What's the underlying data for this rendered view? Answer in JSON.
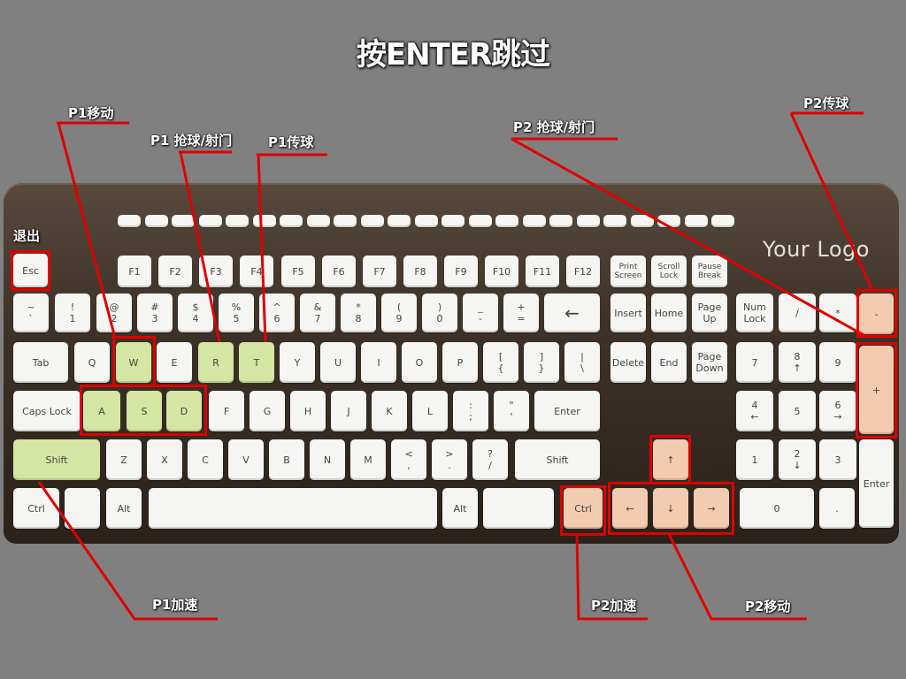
{
  "title": "按ENTER跳过",
  "logo": "Your Logo",
  "labels": {
    "exit": "退出",
    "p1_move": "P1移动",
    "p1_shoot": "P1 抢球/射门",
    "p1_pass": "P1传球",
    "p1_speed": "P1加速",
    "p2_shoot": "P2 抢球/射门",
    "p2_pass": "P2传球",
    "p2_speed": "P2加速",
    "p2_move": "P2移动"
  },
  "keys": {
    "esc": "Esc",
    "f1": "F1",
    "f2": "F2",
    "f3": "F3",
    "f4": "F4",
    "f5": "F5",
    "f6": "F6",
    "f7": "F7",
    "f8": "F8",
    "f9": "F9",
    "f10": "F10",
    "f11": "F11",
    "f12": "F12",
    "print": "Print\nScreen",
    "scroll": "Scroll\nLock",
    "pause": "Pause\nBreak",
    "tilde": "~\n`",
    "n1": "!\n1",
    "n2": "@\n2",
    "n3": "#\n3",
    "n4": "$\n4",
    "n5": "%\n5",
    "n6": "^\n6",
    "n7": "&\n7",
    "n8": "*\n8",
    "n9": "(\n9",
    "n0": ")\n0",
    "minus": "_\n-",
    "plus": "+\n=",
    "backspace": "←",
    "insert": "Insert",
    "home": "Home",
    "pgup": "Page\nUp",
    "numlock": "Num\nLock",
    "np_div": "/",
    "np_mul": "*",
    "np_minus": "-",
    "tab": "Tab",
    "q": "Q",
    "w": "W",
    "e": "E",
    "r": "R",
    "t": "T",
    "y": "Y",
    "u": "U",
    "i": "I",
    "o": "O",
    "p": "P",
    "lbrace": "[\n{",
    "rbrace": "]\n}",
    "bslash": "|\n\\",
    "delete": "Delete",
    "end": "End",
    "pgdn": "Page\nDown",
    "np7": "7",
    "np8": "8\n↑",
    "np9": "9",
    "np_plus": "+",
    "caps": "Caps Lock",
    "a": "A",
    "s": "S",
    "d": "D",
    "f": "F",
    "g": "G",
    "h": "H",
    "j": "J",
    "k": "K",
    "l": "L",
    "semi": ":\n;",
    "quote": "\"\n'",
    "enter": "Enter",
    "np4": "4\n←",
    "np5": "5",
    "np6": "6\n→",
    "lshift": "Shift",
    "z": "Z",
    "x": "X",
    "c": "C",
    "v": "V",
    "b": "B",
    "n": "N",
    "m": "M",
    "comma": "<\n,",
    "period": ">\n.",
    "slash": "?\n/",
    "rshift": "Shift",
    "up": "↑",
    "np1": "1",
    "np2": "2\n↓",
    "np3": "3",
    "np_enter": "Enter",
    "lctrl": "Ctrl",
    "lwin": "",
    "lalt": "Alt",
    "space": "",
    "ralt": "Alt",
    "rwin": "",
    "rctrl": "Ctrl",
    "left": "←",
    "down": "↓",
    "right": "→",
    "np0": "0",
    "np_dot": "."
  },
  "colors": {
    "p1_keys": "#d5e6a4",
    "p2_keys": "#f3cbb0",
    "highlight": "#e00000"
  }
}
